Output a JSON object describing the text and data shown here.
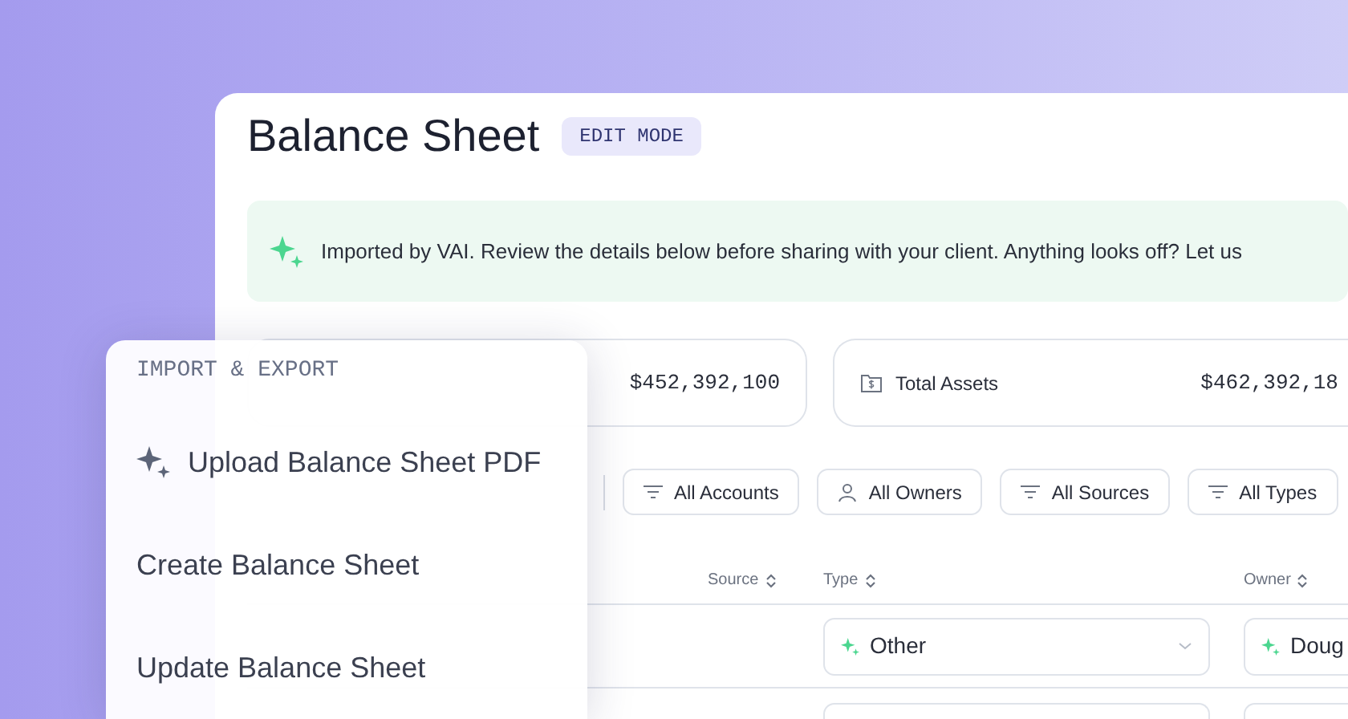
{
  "page": {
    "title": "Balance Sheet",
    "mode_badge": "EDIT MODE"
  },
  "banner": {
    "text": "Imported by VAI. Review the details below before sharing with your client. Anything looks off? Let us"
  },
  "stat_cards": [
    {
      "value": "$452,392,100"
    },
    {
      "label": "Total Assets",
      "value": "$462,392,18"
    }
  ],
  "filters": [
    {
      "kind": "filter",
      "label": "All Accounts"
    },
    {
      "kind": "person",
      "label": "All Owners"
    },
    {
      "kind": "filter",
      "label": "All Sources"
    },
    {
      "kind": "filter",
      "label": "All Types"
    }
  ],
  "table": {
    "columns": [
      "Source",
      "Type",
      "Owner"
    ],
    "rows": [
      {
        "type": "Other",
        "owner": "Doug"
      }
    ]
  },
  "menu": {
    "heading": "IMPORT & EXPORT",
    "items": [
      {
        "kind": "ai",
        "label": "Upload Balance Sheet PDF"
      },
      {
        "kind": "plain",
        "label": "Create Balance Sheet"
      },
      {
        "kind": "plain",
        "label": "Update Balance Sheet"
      }
    ]
  }
}
